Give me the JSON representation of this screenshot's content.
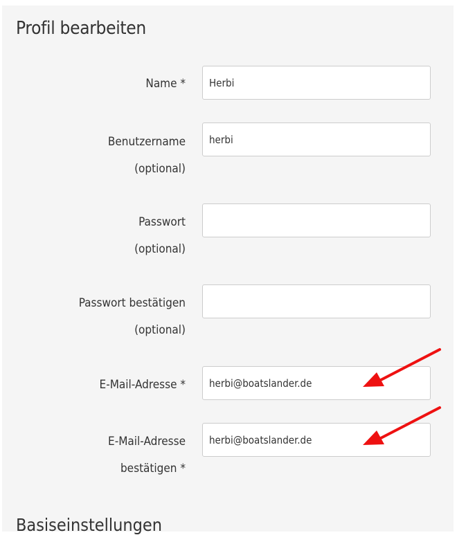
{
  "profile": {
    "title": "Profil bearbeiten",
    "fields": {
      "name": {
        "label": "Name *",
        "value": "Herbi"
      },
      "username": {
        "label_line1": "Benutzername",
        "label_line2": "(optional)",
        "value": "herbi"
      },
      "password": {
        "label_line1": "Passwort",
        "label_line2": "(optional)",
        "value": ""
      },
      "password_confirm": {
        "label_line1": "Passwort bestätigen",
        "label_line2": "(optional)",
        "value": ""
      },
      "email": {
        "label": "E-Mail-Adresse *",
        "value": "herbi@boatslander.de"
      },
      "email_confirm": {
        "label_line1": "E-Mail-Adresse",
        "label_line2": "bestätigen *",
        "value": "herbi@boatslander.de"
      }
    }
  },
  "next_section": {
    "title": "Basiseinstellungen"
  },
  "annotations": {
    "arrow_color": "#ee1111"
  }
}
